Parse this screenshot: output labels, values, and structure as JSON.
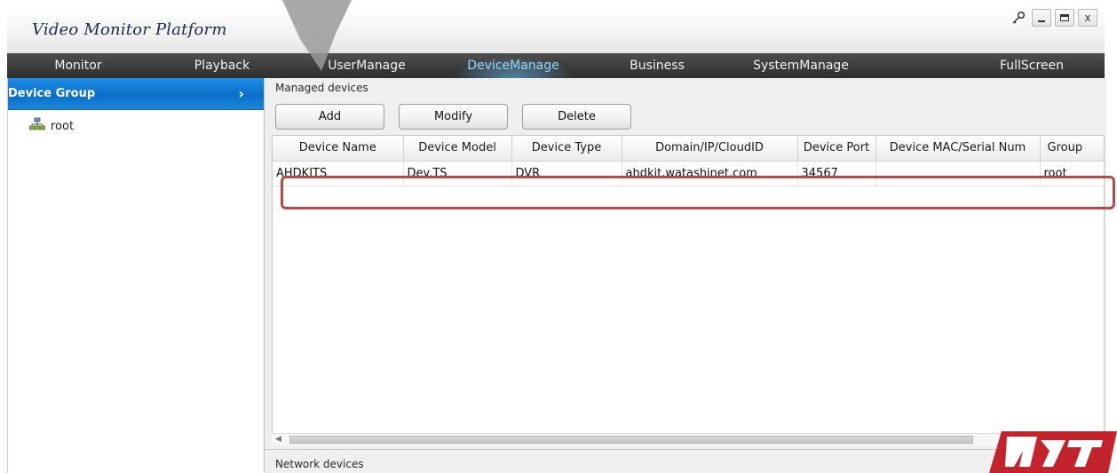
{
  "window": {
    "title": "Video Monitor Platform",
    "controls": {
      "settings_icon": "key-icon",
      "minimize": "_",
      "maximize": "□",
      "close": "x"
    }
  },
  "menu": {
    "items": [
      {
        "label": "Monitor",
        "active": false
      },
      {
        "label": "Playback",
        "active": false
      },
      {
        "label": "UserManage",
        "active": false
      },
      {
        "label": "DeviceManage",
        "active": true
      },
      {
        "label": "Business",
        "active": false
      },
      {
        "label": "SystemManage",
        "active": false
      },
      {
        "label": "FullScreen",
        "active": false
      }
    ]
  },
  "sidebar": {
    "header": "Device Group",
    "tree": [
      {
        "label": "root",
        "icon": "network-tree-icon"
      }
    ]
  },
  "managed": {
    "title": "Managed devices",
    "buttons": {
      "add": "Add",
      "modify": "Modify",
      "delete": "Delete"
    },
    "columns": [
      "Device Name",
      "Device Model",
      "Device Type",
      "Domain/IP/CloudID",
      "Device Port",
      "Device MAC/Serial Num",
      "Group"
    ],
    "rows": [
      [
        "AHDKITS",
        "Dev.TS",
        "DVR",
        "ahdkit.watashinet.com",
        "34567",
        "",
        "root"
      ]
    ]
  },
  "network": {
    "title": "Network devices"
  },
  "colors": {
    "accent": "#0a6fc9",
    "menu_bg": "#2e2e2e",
    "menu_active": "#8fd8ff",
    "highlight": "#b44b48",
    "logo": "#c3242b"
  }
}
